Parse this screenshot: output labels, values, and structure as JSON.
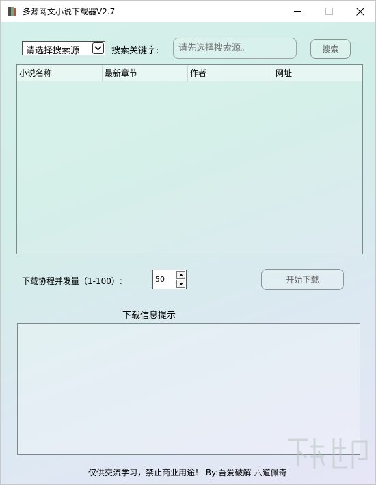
{
  "window": {
    "title": "多源网文小说下载器V2.7",
    "icon": "book-app-icon"
  },
  "search": {
    "source_select_value": "请选择搜索源",
    "keyword_label": "搜索关键字:",
    "keyword_placeholder": "请先选择搜索源。",
    "search_button_label": "搜索"
  },
  "results_table": {
    "columns": [
      "小说名称",
      "最新章节",
      "作者",
      "网址"
    ],
    "rows": []
  },
  "download": {
    "concurrency_label": "下载协程并发量（1-100）:",
    "concurrency_value": "50",
    "start_button_label": "开始下载"
  },
  "log": {
    "title": "下载信息提示",
    "content": ""
  },
  "footer": {
    "text": "仅供交流学习，禁止商业用途！ By:吾爱破解-六道佩奇"
  },
  "colors": {
    "background_start": "#d5f0ea",
    "background_end": "#e6e6f6",
    "titlebar": "#ffffff",
    "button_text_disabled": "#666666"
  }
}
